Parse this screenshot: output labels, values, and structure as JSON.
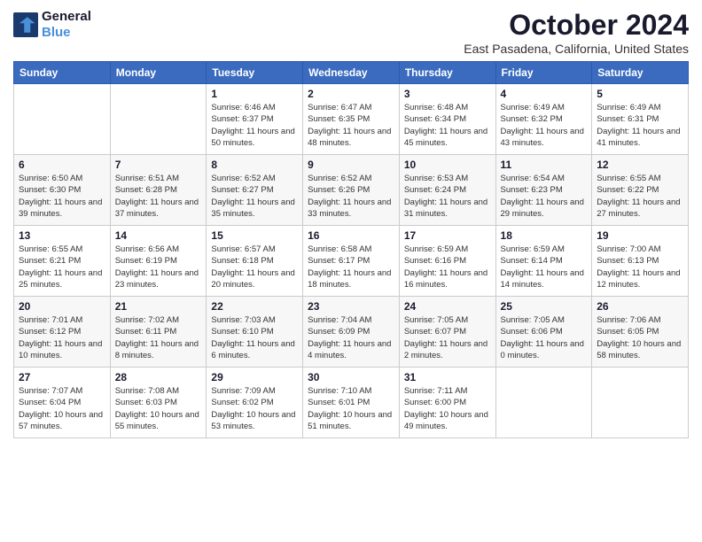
{
  "header": {
    "logo_line1": "General",
    "logo_line2": "Blue",
    "title": "October 2024",
    "subtitle": "East Pasadena, California, United States"
  },
  "days_of_week": [
    "Sunday",
    "Monday",
    "Tuesday",
    "Wednesday",
    "Thursday",
    "Friday",
    "Saturday"
  ],
  "weeks": [
    [
      {
        "day": "",
        "sunrise": "",
        "sunset": "",
        "daylight": ""
      },
      {
        "day": "",
        "sunrise": "",
        "sunset": "",
        "daylight": ""
      },
      {
        "day": "1",
        "sunrise": "Sunrise: 6:46 AM",
        "sunset": "Sunset: 6:37 PM",
        "daylight": "Daylight: 11 hours and 50 minutes."
      },
      {
        "day": "2",
        "sunrise": "Sunrise: 6:47 AM",
        "sunset": "Sunset: 6:35 PM",
        "daylight": "Daylight: 11 hours and 48 minutes."
      },
      {
        "day": "3",
        "sunrise": "Sunrise: 6:48 AM",
        "sunset": "Sunset: 6:34 PM",
        "daylight": "Daylight: 11 hours and 45 minutes."
      },
      {
        "day": "4",
        "sunrise": "Sunrise: 6:49 AM",
        "sunset": "Sunset: 6:32 PM",
        "daylight": "Daylight: 11 hours and 43 minutes."
      },
      {
        "day": "5",
        "sunrise": "Sunrise: 6:49 AM",
        "sunset": "Sunset: 6:31 PM",
        "daylight": "Daylight: 11 hours and 41 minutes."
      }
    ],
    [
      {
        "day": "6",
        "sunrise": "Sunrise: 6:50 AM",
        "sunset": "Sunset: 6:30 PM",
        "daylight": "Daylight: 11 hours and 39 minutes."
      },
      {
        "day": "7",
        "sunrise": "Sunrise: 6:51 AM",
        "sunset": "Sunset: 6:28 PM",
        "daylight": "Daylight: 11 hours and 37 minutes."
      },
      {
        "day": "8",
        "sunrise": "Sunrise: 6:52 AM",
        "sunset": "Sunset: 6:27 PM",
        "daylight": "Daylight: 11 hours and 35 minutes."
      },
      {
        "day": "9",
        "sunrise": "Sunrise: 6:52 AM",
        "sunset": "Sunset: 6:26 PM",
        "daylight": "Daylight: 11 hours and 33 minutes."
      },
      {
        "day": "10",
        "sunrise": "Sunrise: 6:53 AM",
        "sunset": "Sunset: 6:24 PM",
        "daylight": "Daylight: 11 hours and 31 minutes."
      },
      {
        "day": "11",
        "sunrise": "Sunrise: 6:54 AM",
        "sunset": "Sunset: 6:23 PM",
        "daylight": "Daylight: 11 hours and 29 minutes."
      },
      {
        "day": "12",
        "sunrise": "Sunrise: 6:55 AM",
        "sunset": "Sunset: 6:22 PM",
        "daylight": "Daylight: 11 hours and 27 minutes."
      }
    ],
    [
      {
        "day": "13",
        "sunrise": "Sunrise: 6:55 AM",
        "sunset": "Sunset: 6:21 PM",
        "daylight": "Daylight: 11 hours and 25 minutes."
      },
      {
        "day": "14",
        "sunrise": "Sunrise: 6:56 AM",
        "sunset": "Sunset: 6:19 PM",
        "daylight": "Daylight: 11 hours and 23 minutes."
      },
      {
        "day": "15",
        "sunrise": "Sunrise: 6:57 AM",
        "sunset": "Sunset: 6:18 PM",
        "daylight": "Daylight: 11 hours and 20 minutes."
      },
      {
        "day": "16",
        "sunrise": "Sunrise: 6:58 AM",
        "sunset": "Sunset: 6:17 PM",
        "daylight": "Daylight: 11 hours and 18 minutes."
      },
      {
        "day": "17",
        "sunrise": "Sunrise: 6:59 AM",
        "sunset": "Sunset: 6:16 PM",
        "daylight": "Daylight: 11 hours and 16 minutes."
      },
      {
        "day": "18",
        "sunrise": "Sunrise: 6:59 AM",
        "sunset": "Sunset: 6:14 PM",
        "daylight": "Daylight: 11 hours and 14 minutes."
      },
      {
        "day": "19",
        "sunrise": "Sunrise: 7:00 AM",
        "sunset": "Sunset: 6:13 PM",
        "daylight": "Daylight: 11 hours and 12 minutes."
      }
    ],
    [
      {
        "day": "20",
        "sunrise": "Sunrise: 7:01 AM",
        "sunset": "Sunset: 6:12 PM",
        "daylight": "Daylight: 11 hours and 10 minutes."
      },
      {
        "day": "21",
        "sunrise": "Sunrise: 7:02 AM",
        "sunset": "Sunset: 6:11 PM",
        "daylight": "Daylight: 11 hours and 8 minutes."
      },
      {
        "day": "22",
        "sunrise": "Sunrise: 7:03 AM",
        "sunset": "Sunset: 6:10 PM",
        "daylight": "Daylight: 11 hours and 6 minutes."
      },
      {
        "day": "23",
        "sunrise": "Sunrise: 7:04 AM",
        "sunset": "Sunset: 6:09 PM",
        "daylight": "Daylight: 11 hours and 4 minutes."
      },
      {
        "day": "24",
        "sunrise": "Sunrise: 7:05 AM",
        "sunset": "Sunset: 6:07 PM",
        "daylight": "Daylight: 11 hours and 2 minutes."
      },
      {
        "day": "25",
        "sunrise": "Sunrise: 7:05 AM",
        "sunset": "Sunset: 6:06 PM",
        "daylight": "Daylight: 11 hours and 0 minutes."
      },
      {
        "day": "26",
        "sunrise": "Sunrise: 7:06 AM",
        "sunset": "Sunset: 6:05 PM",
        "daylight": "Daylight: 10 hours and 58 minutes."
      }
    ],
    [
      {
        "day": "27",
        "sunrise": "Sunrise: 7:07 AM",
        "sunset": "Sunset: 6:04 PM",
        "daylight": "Daylight: 10 hours and 57 minutes."
      },
      {
        "day": "28",
        "sunrise": "Sunrise: 7:08 AM",
        "sunset": "Sunset: 6:03 PM",
        "daylight": "Daylight: 10 hours and 55 minutes."
      },
      {
        "day": "29",
        "sunrise": "Sunrise: 7:09 AM",
        "sunset": "Sunset: 6:02 PM",
        "daylight": "Daylight: 10 hours and 53 minutes."
      },
      {
        "day": "30",
        "sunrise": "Sunrise: 7:10 AM",
        "sunset": "Sunset: 6:01 PM",
        "daylight": "Daylight: 10 hours and 51 minutes."
      },
      {
        "day": "31",
        "sunrise": "Sunrise: 7:11 AM",
        "sunset": "Sunset: 6:00 PM",
        "daylight": "Daylight: 10 hours and 49 minutes."
      },
      {
        "day": "",
        "sunrise": "",
        "sunset": "",
        "daylight": ""
      },
      {
        "day": "",
        "sunrise": "",
        "sunset": "",
        "daylight": ""
      }
    ]
  ]
}
